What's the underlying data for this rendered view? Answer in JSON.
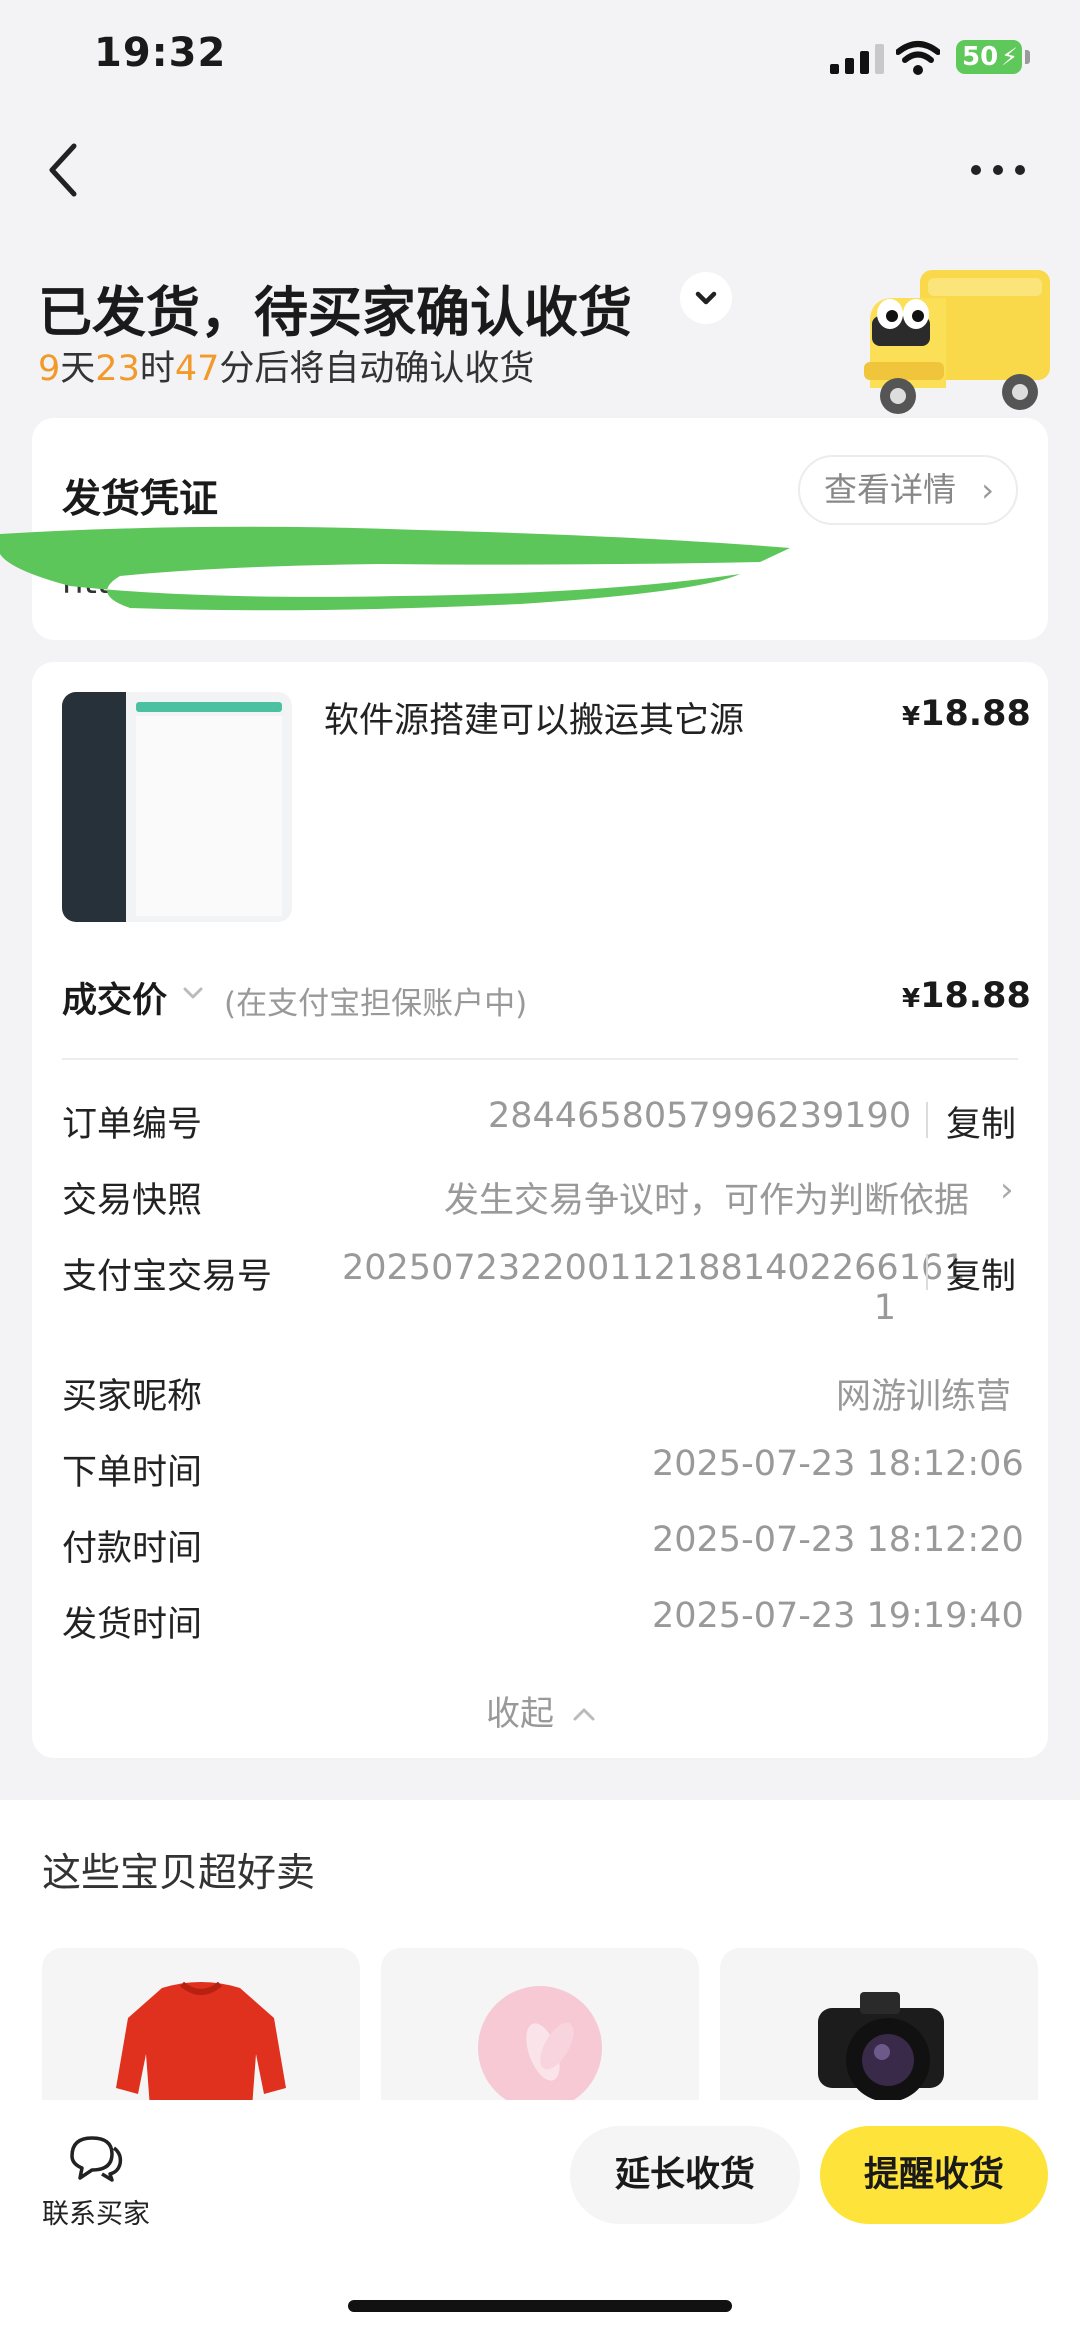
{
  "status_bar": {
    "time": "19:32",
    "battery": "50"
  },
  "header": {
    "title": "已发货，待买家确认收货",
    "countdown": {
      "days": "9",
      "days_unit": "天",
      "hours": "23",
      "hours_unit": "时",
      "minutes": "47",
      "suffix": "分后将自动确认收货"
    }
  },
  "voucher": {
    "title": "发货凭证",
    "detail_button": "查看详情",
    "link_visible": "htt"
  },
  "item": {
    "name": "软件源搭建可以搬运其它源",
    "price_symbol": "¥",
    "price": "18.88"
  },
  "deal": {
    "label": "成交价",
    "note": "(在支付宝担保账户中)",
    "price_symbol": "¥",
    "price": "18.88"
  },
  "order_info": {
    "order_no": {
      "label": "订单编号",
      "value": "2844658057996239190",
      "copy": "复制"
    },
    "snapshot": {
      "label": "交易快照",
      "value": "发生交易争议时，可作为判断依据"
    },
    "alipay_no": {
      "label": "支付宝交易号",
      "value_line1": "2025072322001121881402266161",
      "value_line2": "1",
      "copy": "复制"
    },
    "buyer": {
      "label": "买家昵称",
      "value": "网游训练营"
    },
    "order_time": {
      "label": "下单时间",
      "value": "2025-07-23 18:12:06"
    },
    "pay_time": {
      "label": "付款时间",
      "value": "2025-07-23 18:12:20"
    },
    "ship_time": {
      "label": "发货时间",
      "value": "2025-07-23 19:19:40"
    },
    "collapse": "收起"
  },
  "recommendations": {
    "title": "这些宝贝超好卖"
  },
  "bottom_bar": {
    "contact": "联系买家",
    "extend": "延长收货",
    "remind": "提醒收货"
  },
  "colors": {
    "accent_orange": "#f19a2a",
    "primary_yellow": "#fde33a",
    "battery_green": "#5fc85a"
  }
}
